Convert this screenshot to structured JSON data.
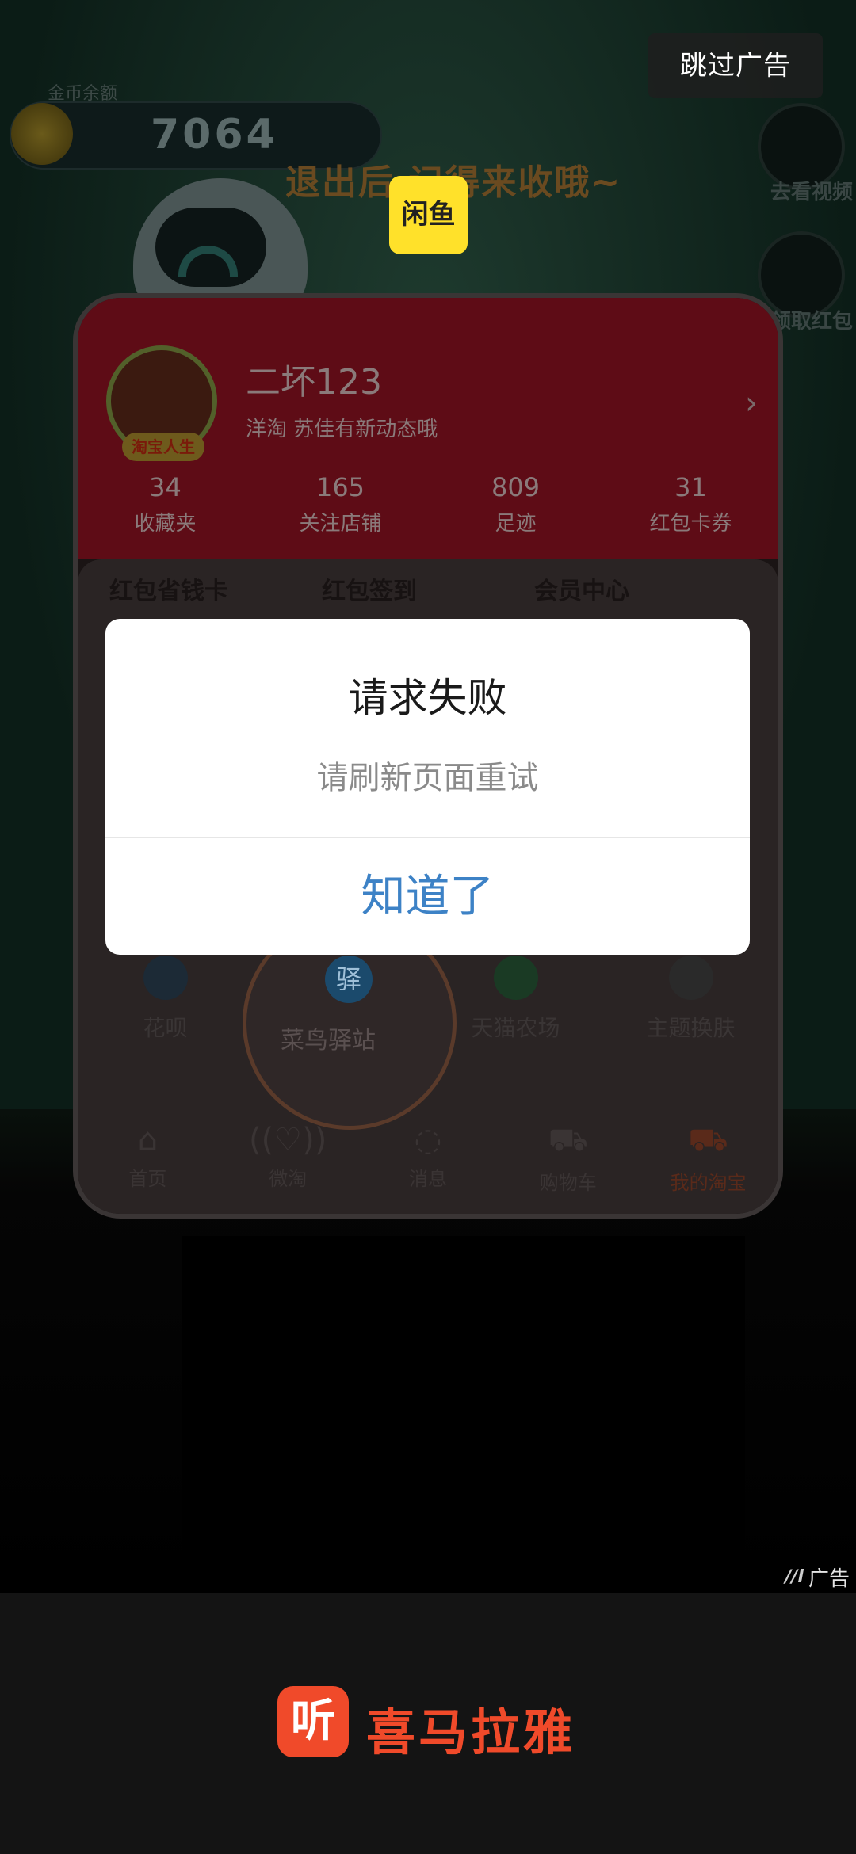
{
  "ad": {
    "skip_label": "跳过广告",
    "ad_label": "广告",
    "ad_mark": "//l",
    "creative": {
      "coin_hint": "金币余额",
      "coin_value": "7064",
      "banner_text": "退出后 记得来收哦~",
      "side_items": [
        "去看视频",
        "领取红包"
      ],
      "xianyu_logo": "闲鱼",
      "profile": {
        "username": "二坏123",
        "badge": "淘宝人生",
        "dynamic": "洋淘 苏佳有新动态哦",
        "stats": [
          {
            "value": "34",
            "label": "收藏夹"
          },
          {
            "value": "165",
            "label": "关注店铺"
          },
          {
            "value": "809",
            "label": "足迹"
          },
          {
            "value": "31",
            "label": "红包卡券"
          }
        ],
        "quick_items": [
          "红包省钱卡",
          "红包签到",
          "会员中心"
        ],
        "tools": [
          "花呗",
          "菜鸟驿站",
          "天猫农场",
          "主题换肤"
        ],
        "cainiao_icon": "驿",
        "tabs": [
          "首页",
          "微淘",
          "消息",
          "购物车",
          "我的淘宝"
        ]
      }
    }
  },
  "dialog": {
    "title": "请求失败",
    "message": "请刷新页面重试",
    "confirm_label": "知道了"
  },
  "brand": {
    "logo_glyph": "听",
    "name": "喜马拉雅"
  },
  "colors": {
    "dialog_button": "#3d82c6",
    "brand": "#f04a2a",
    "xianyu": "#ffe12a"
  }
}
